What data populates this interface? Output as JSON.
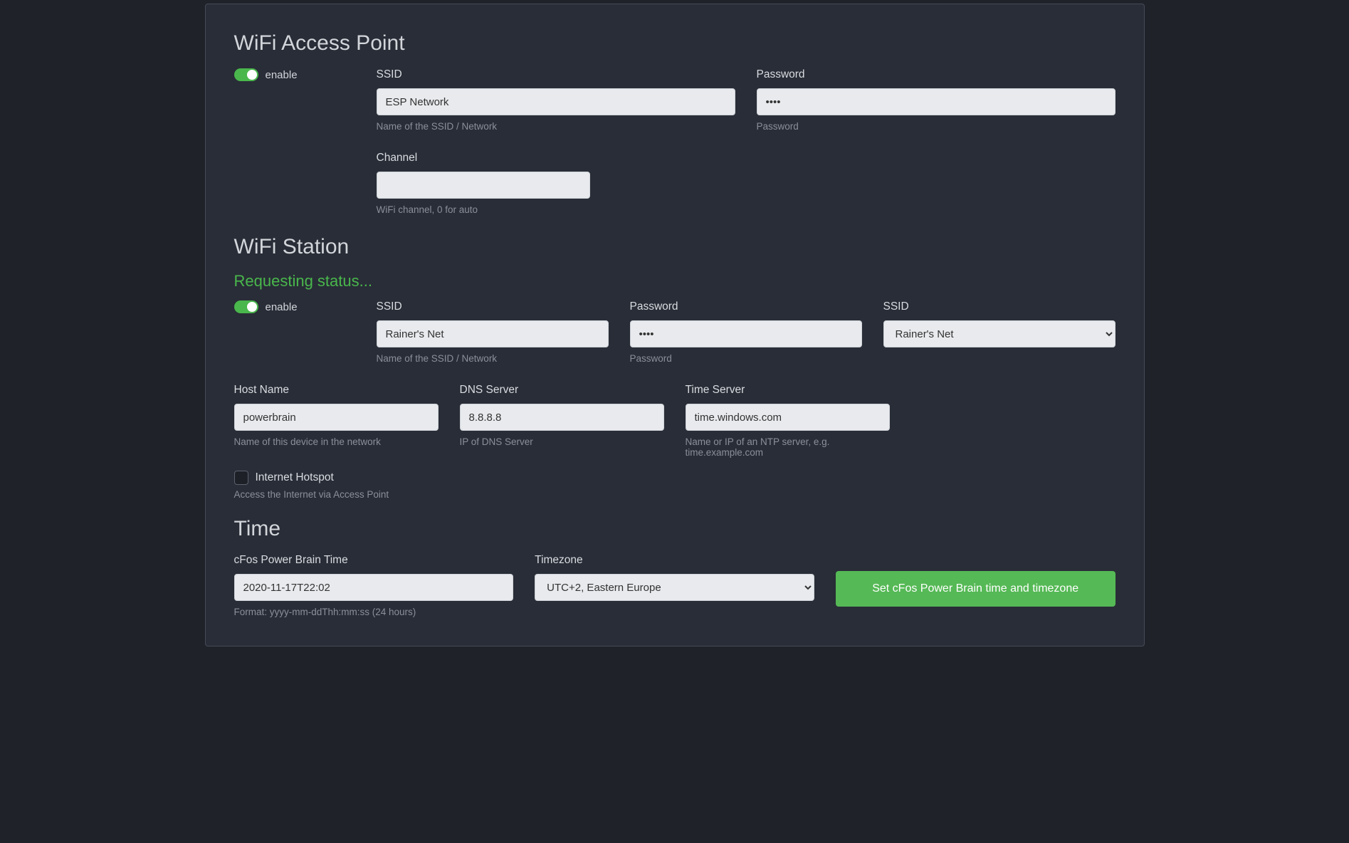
{
  "ap": {
    "heading": "WiFi Access Point",
    "enable_label": "enable",
    "ssid_label": "SSID",
    "ssid_value": "ESP Network",
    "ssid_hint": "Name of the SSID / Network",
    "password_label": "Password",
    "password_value": "••••",
    "password_hint": "Password",
    "channel_label": "Channel",
    "channel_value": "",
    "channel_hint": "WiFi channel, 0 for auto"
  },
  "station": {
    "heading": "WiFi Station",
    "status": "Requesting status...",
    "enable_label": "enable",
    "ssid_label": "SSID",
    "ssid_value": "Rainer's Net",
    "ssid_hint": "Name of the SSID / Network",
    "password_label": "Password",
    "password_value": "••••",
    "password_hint": "Password",
    "ssid_select_label": "SSID",
    "ssid_select_value": "Rainer's Net",
    "host_label": "Host Name",
    "host_value": "powerbrain",
    "host_hint": "Name of this device in the network",
    "dns_label": "DNS Server",
    "dns_value": "8.8.8.8",
    "dns_hint": "IP of DNS Server",
    "timeserver_label": "Time Server",
    "timeserver_value": "time.windows.com",
    "timeserver_hint": "Name or IP of an NTP server, e.g. time.example.com",
    "hotspot_label": "Internet Hotspot",
    "hotspot_hint": "Access the Internet via Access Point"
  },
  "time": {
    "heading": "Time",
    "pbtime_label": "cFos Power Brain Time",
    "pbtime_value": "2020-11-17T22:02",
    "pbtime_hint": "Format: yyyy-mm-ddThh:mm:ss (24 hours)",
    "tz_label": "Timezone",
    "tz_value": "UTC+2, Eastern Europe",
    "button_label": "Set cFos Power Brain time and timezone"
  }
}
